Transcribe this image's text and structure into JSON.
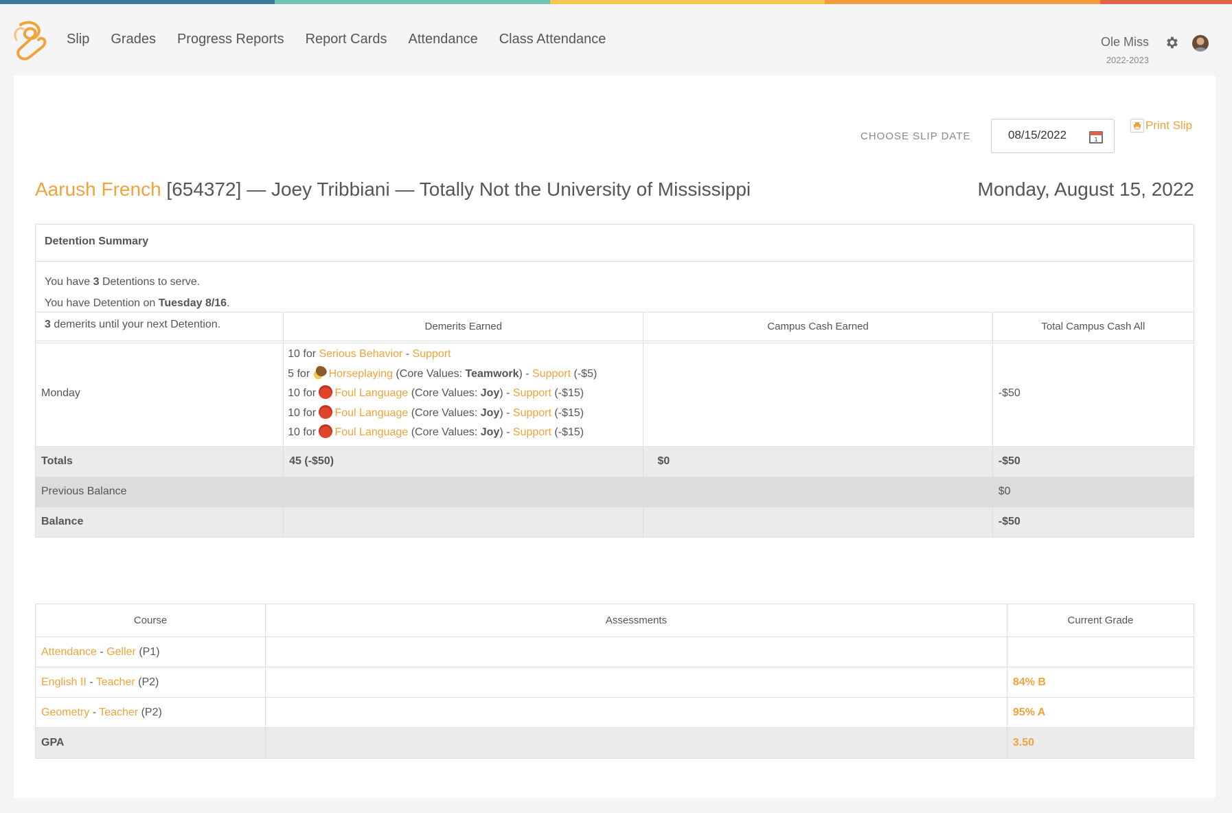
{
  "colors": {
    "accent": "#f0a33a",
    "topbar": [
      "#3a7b99",
      "#6cc3b0",
      "#f3c84e",
      "#f29c3e",
      "#e0624a"
    ]
  },
  "nav": {
    "links": [
      "Slip",
      "Grades",
      "Progress Reports",
      "Report Cards",
      "Attendance",
      "Class Attendance"
    ],
    "school_name": "Ole Miss",
    "school_year": "2022-2023"
  },
  "slip": {
    "choose_label": "CHOOSE SLIP DATE",
    "date_value": "08/15/2022",
    "print_label": "Print Slip",
    "student_name": "Aarush French",
    "heading_rest": " [654372] — Joey Tribbiani — Totally Not the University of Mississippi",
    "date_long": "Monday, August 15, 2022"
  },
  "detention": {
    "title": "Detention Summary",
    "line1_pre": "You have ",
    "line1_num": "3",
    "line1_post": " Detentions to serve.",
    "line2_pre": "You have Detention on ",
    "line2_bold": "Tuesday 8/16",
    "line2_post": ".",
    "line3_num": "3",
    "line3_post": " demerits until your next Detention."
  },
  "behavior": {
    "headers": [
      "Demerits Earned",
      "Campus Cash Earned",
      "Total Campus Cash All"
    ],
    "day_label": "Monday",
    "demerits": [
      {
        "points": "10",
        "for": " for ",
        "behavior": "Serious Behavior",
        "core_value": "",
        "staff": "Support",
        "cash": ""
      },
      {
        "points": "5",
        "for": " for ",
        "behavior": "Horseplaying",
        "core_value": "Teamwork",
        "staff": "Support",
        "cash": "(-$5)"
      },
      {
        "points": "10",
        "for": " for ",
        "behavior": "Foul Language",
        "core_value": "Joy",
        "staff": "Support",
        "cash": "(-$15)"
      },
      {
        "points": "10",
        "for": " for ",
        "behavior": "Foul Language",
        "core_value": "Joy",
        "staff": "Support",
        "cash": "(-$15)"
      },
      {
        "points": "10",
        "for": " for ",
        "behavior": "Foul Language",
        "core_value": "Joy",
        "staff": "Support",
        "cash": "(-$15)"
      }
    ],
    "core_values_label": "Core Values: ",
    "day_total_cash": "-$50",
    "totals_label": "Totals",
    "totals_demerits": "45 (-$50)",
    "totals_cash_earned": "$0",
    "totals_cash_all": "-$50",
    "previous_label": "Previous Balance",
    "previous_value": "$0",
    "balance_label": "Balance",
    "balance_value": "-$50"
  },
  "grades": {
    "headers": [
      "Course",
      "Assessments",
      "Current Grade"
    ],
    "courses": [
      {
        "course": "Attendance",
        "teacher": "Geller",
        "period": "(P1)",
        "grade": ""
      },
      {
        "course": "English II",
        "teacher": "Teacher",
        "period": "(P2)",
        "grade": "84% B"
      },
      {
        "course": "Geometry",
        "teacher": "Teacher",
        "period": "(P2)",
        "grade": "95% A"
      }
    ],
    "gpa_label": "GPA",
    "gpa_value": "3.50"
  }
}
